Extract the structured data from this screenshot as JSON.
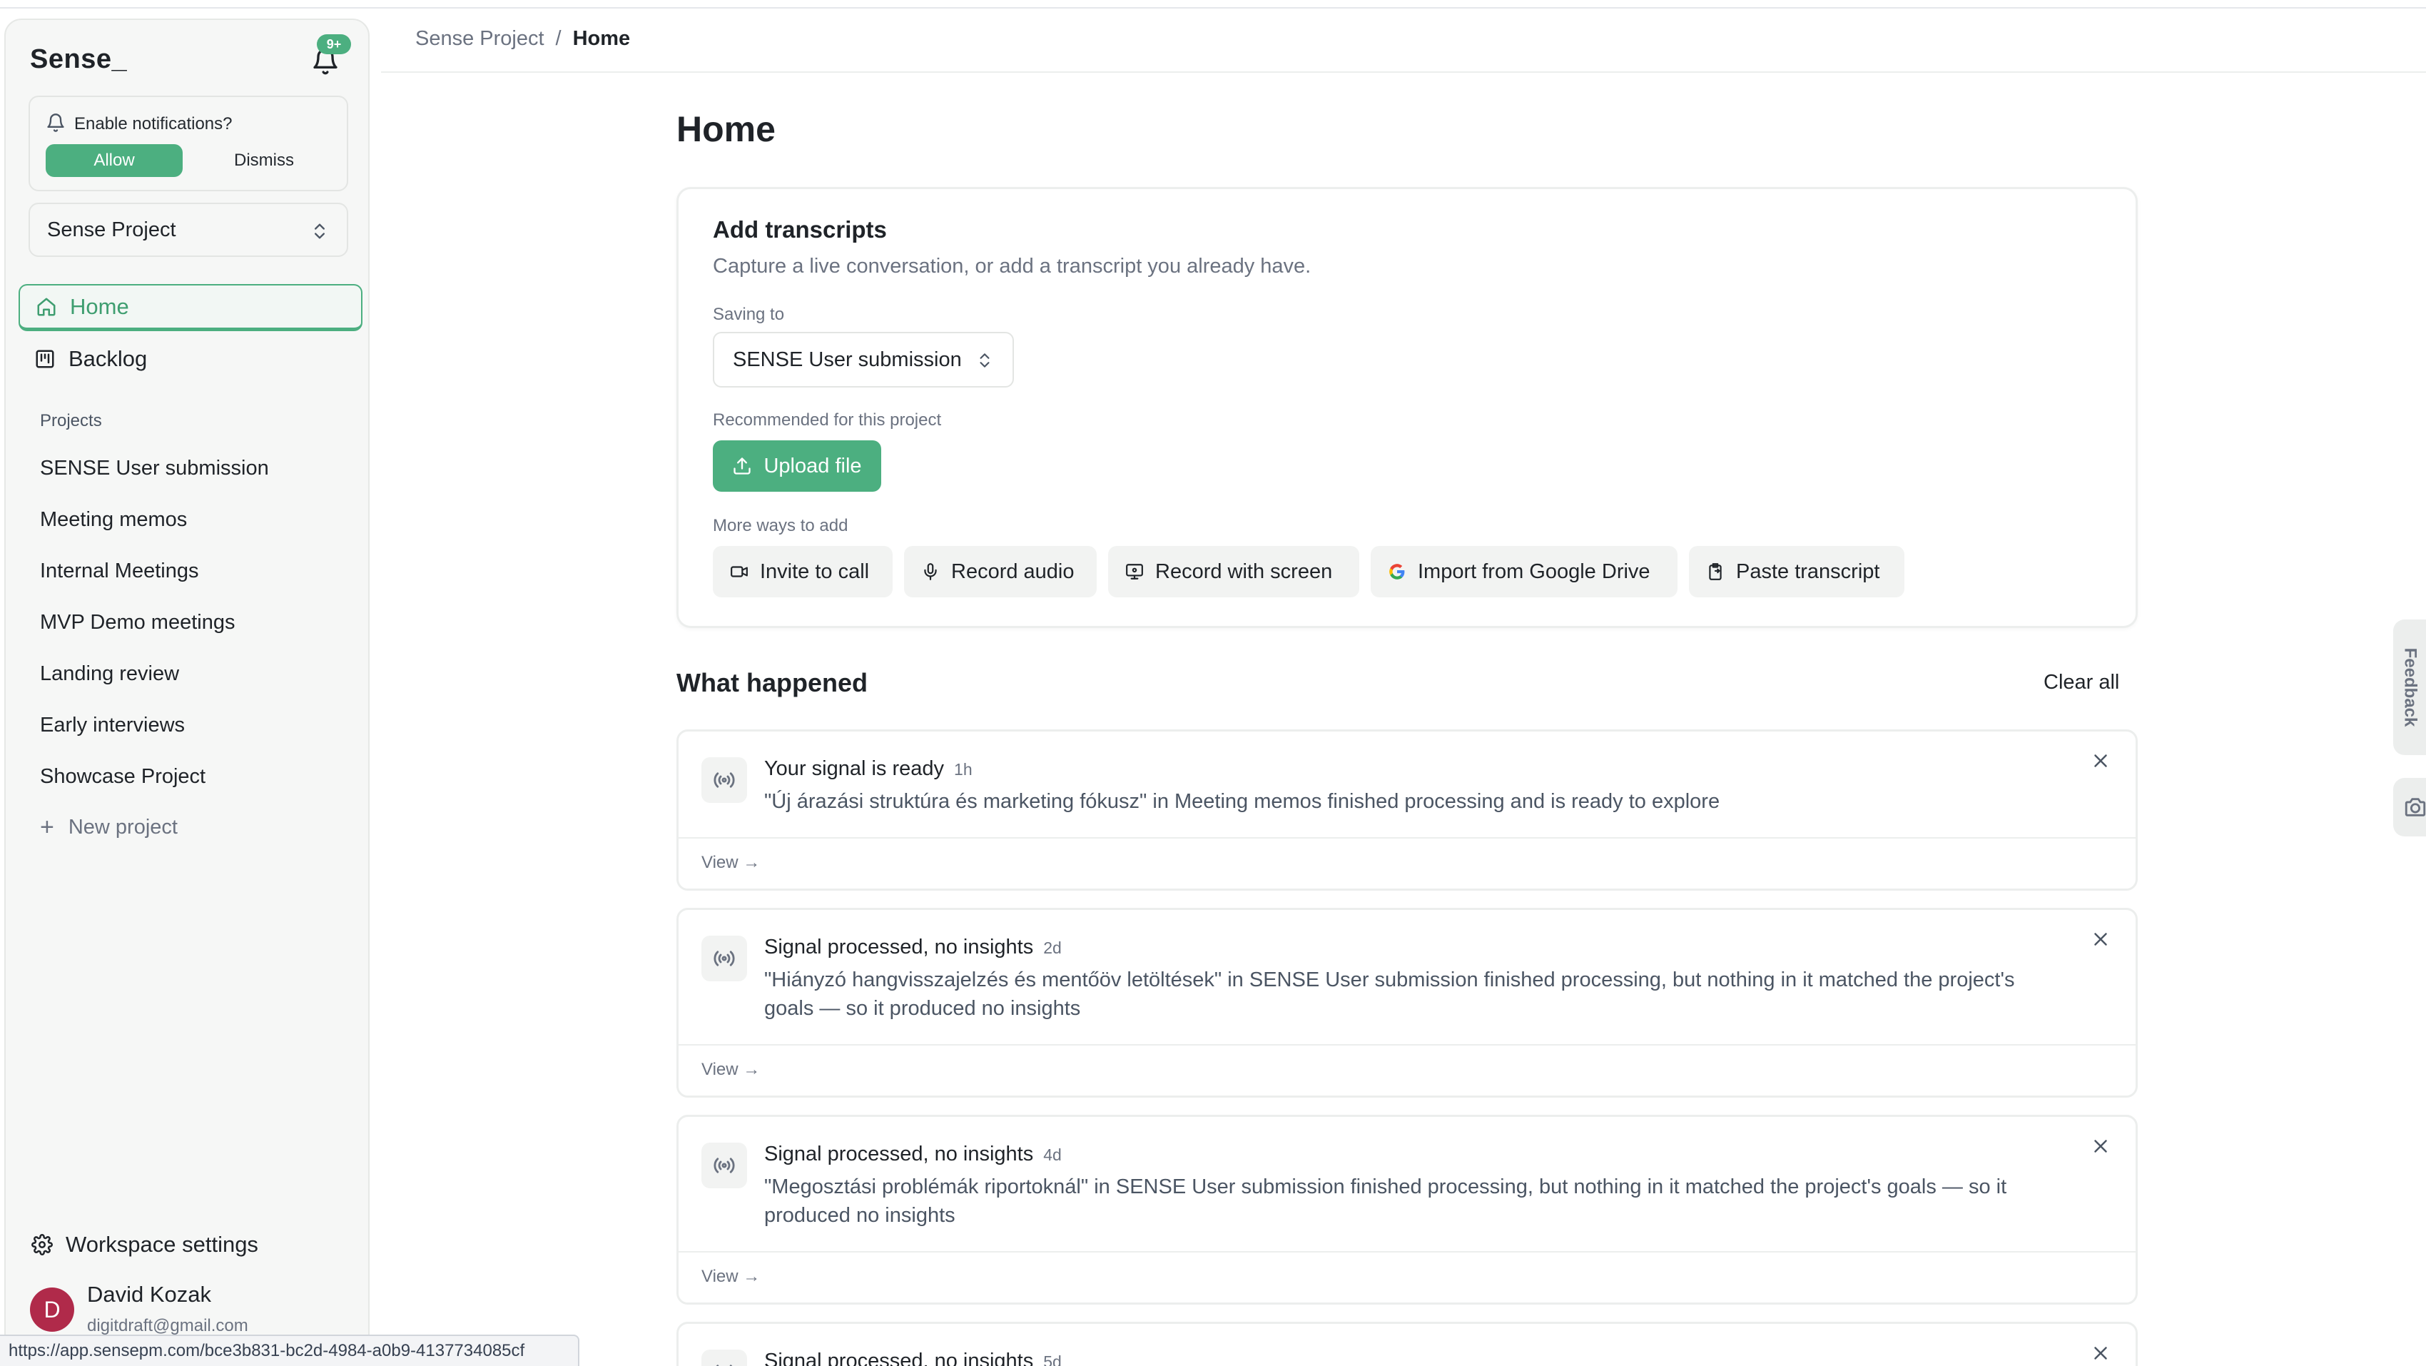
{
  "app": {
    "brand": "Sense_",
    "notification_badge": "9+",
    "accent_color": "#4caf80"
  },
  "notif_prompt": {
    "title": "Enable notifications?",
    "allow": "Allow",
    "dismiss": "Dismiss"
  },
  "project_selector": {
    "value": "Sense Project"
  },
  "nav": {
    "home": "Home",
    "backlog": "Backlog"
  },
  "projects": {
    "label": "Projects",
    "items": [
      "SENSE User submission",
      "Meeting memos",
      "Internal Meetings",
      "MVP Demo meetings",
      "Landing review",
      "Early interviews",
      "Showcase Project"
    ],
    "new_project": "New project"
  },
  "footer": {
    "workspace_settings": "Workspace settings",
    "avatar_initial": "D",
    "user_name": "David Kozak",
    "user_email": "digitdraft@gmail.com",
    "status_url": "https://app.sensepm.com/bce3b831-bc2d-4984-a0b9-4137734085cf"
  },
  "breadcrumb": {
    "parent": "Sense Project",
    "separator": "/",
    "current": "Home"
  },
  "page": {
    "title": "Home"
  },
  "add_transcripts": {
    "title": "Add transcripts",
    "subtitle": "Capture a live conversation, or add a transcript you already have.",
    "saving_to_label": "Saving to",
    "saving_to_value": "SENSE User submission",
    "recommended_label": "Recommended for this project",
    "upload_button": "Upload file",
    "more_ways_label": "More ways to add",
    "ways": {
      "invite": "Invite to call",
      "record_audio": "Record audio",
      "record_screen": "Record with screen",
      "google_drive": "Import from Google Drive",
      "paste": "Paste transcript"
    }
  },
  "what_happened": {
    "title": "What happened",
    "clear_all": "Clear all",
    "view_label": "View →",
    "events": [
      {
        "title": "Your signal is ready",
        "time": "1h",
        "body": "\"Új árazási struktúra és marketing fókusz\" in Meeting memos finished processing and is ready to explore"
      },
      {
        "title": "Signal processed, no insights",
        "time": "2d",
        "body": "\"Hiányzó hangvisszajelzés és mentőöv letöltések\" in SENSE User submission finished processing, but nothing in it matched the project's goals — so it produced no insights"
      },
      {
        "title": "Signal processed, no insights",
        "time": "4d",
        "body": "\"Megosztási problémák riportoknál\" in SENSE User submission finished processing, but nothing in it matched the project's goals — so it produced no insights"
      },
      {
        "title": "Signal processed, no insights",
        "time": "5d",
        "body": ""
      }
    ]
  },
  "side_tabs": {
    "feedback": "Feedback"
  }
}
